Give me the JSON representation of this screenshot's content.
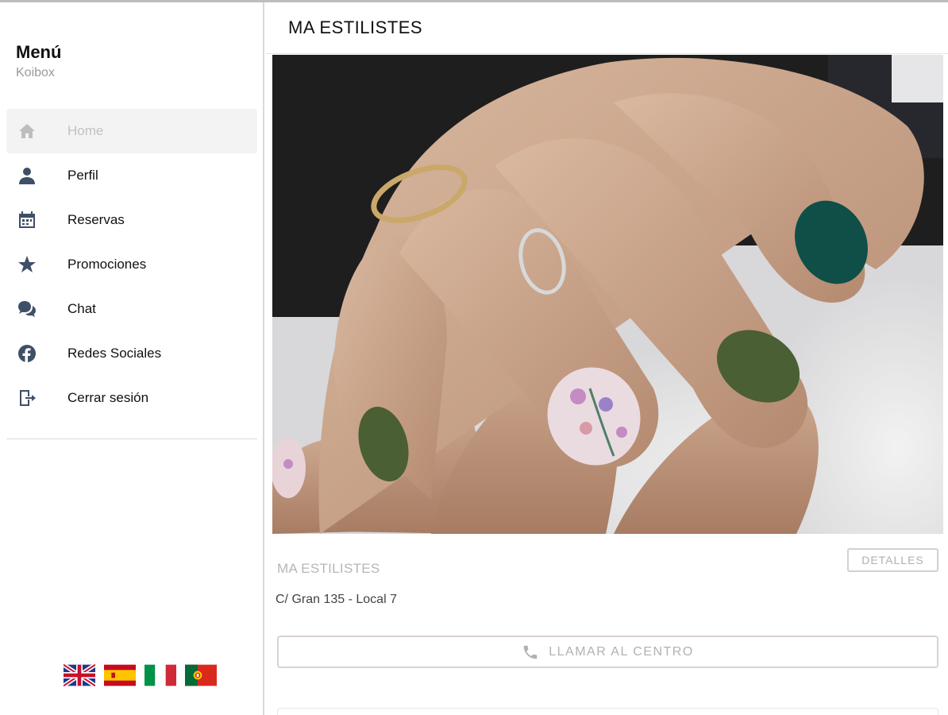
{
  "sidebar": {
    "title": "Menú",
    "subtitle": "Koibox",
    "items": [
      {
        "label": "Home",
        "icon": "home-icon",
        "active": true
      },
      {
        "label": "Perfil",
        "icon": "user-icon",
        "active": false
      },
      {
        "label": "Reservas",
        "icon": "calendar-icon",
        "active": false
      },
      {
        "label": "Promociones",
        "icon": "star-icon",
        "active": false
      },
      {
        "label": "Chat",
        "icon": "chat-icon",
        "active": false
      },
      {
        "label": "Redes Sociales",
        "icon": "facebook-icon",
        "active": false
      },
      {
        "label": "Cerrar sesión",
        "icon": "logout-icon",
        "active": false
      }
    ],
    "languages": [
      "flag-uk-icon",
      "flag-spain-icon",
      "flag-italy-icon",
      "flag-portugal-icon"
    ]
  },
  "main": {
    "header_title": "MA ESTILISTES",
    "salon_name": "MA ESTILISTES",
    "details_label": "DETALLES",
    "address": "C/ Gran 135 - Local 7",
    "call_label": "LLAMAR AL CENTRO",
    "call_icon": "phone-icon"
  },
  "colors": {
    "icon": "#3f4f66",
    "active_bg": "#f4f3f3",
    "muted_text": "#b9b5b5",
    "nail_dark_green": "#4a5f33",
    "nail_teal": "#0f4f48"
  }
}
